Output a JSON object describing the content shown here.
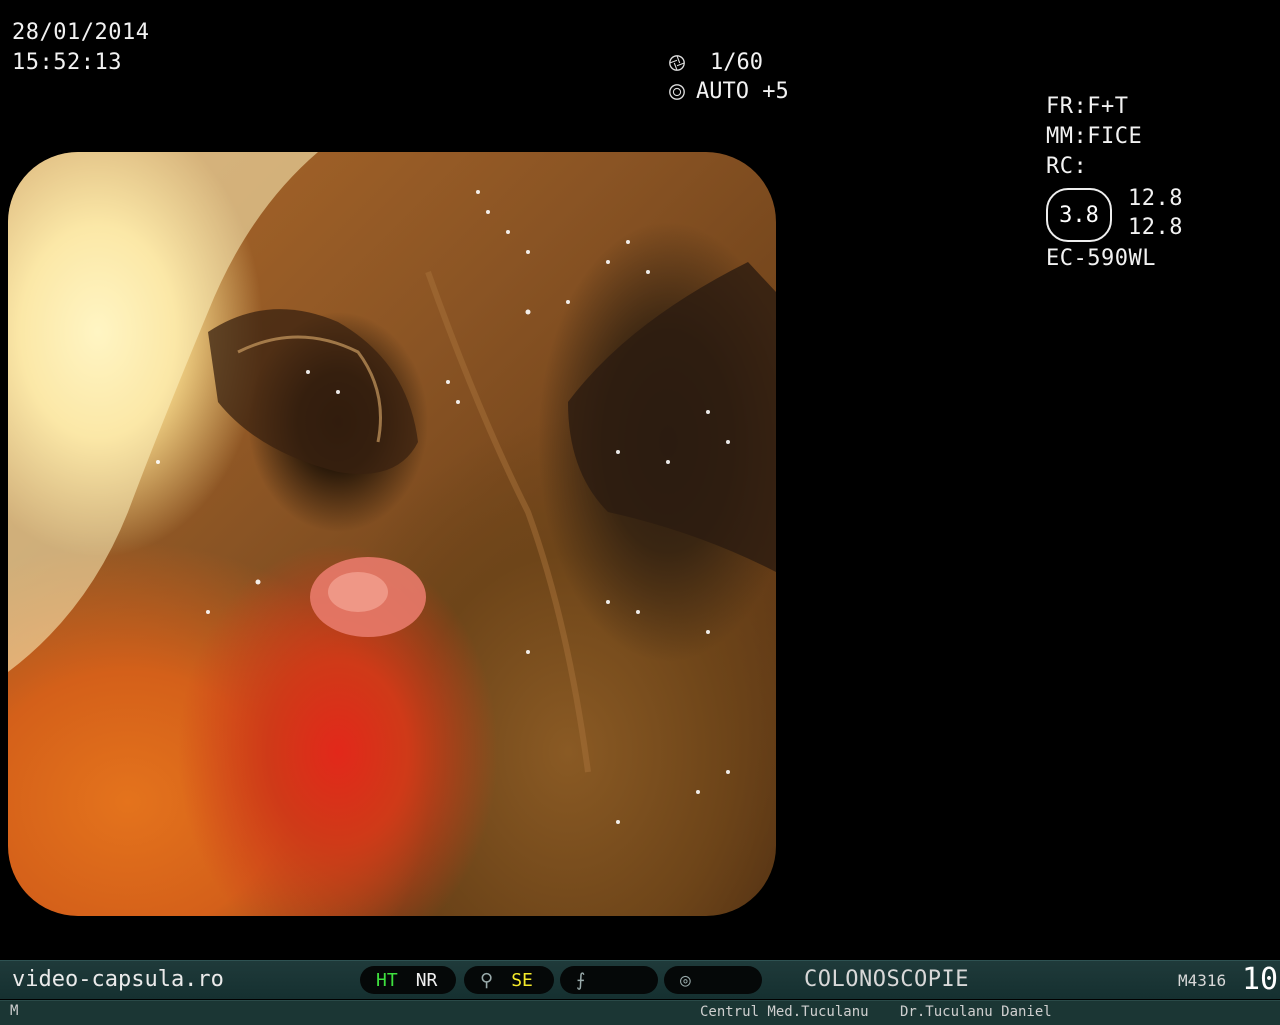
{
  "overlay": {
    "date": "28/01/2014",
    "time": "15:52:13",
    "shutter": "1/60",
    "exposure": "AUTO +5",
    "fr": "FR:F+T",
    "mm": "MM:FICE",
    "rc_label": "RC:",
    "rc_value": "3.8",
    "rc_value_1": "12.8",
    "rc_value_2": "12.8",
    "scope_model": "EC-590WL"
  },
  "status_bar": {
    "watermark": "video-capsula.ro",
    "ht": "HT",
    "nr": "NR",
    "se": "SE",
    "exam_type": "COLONOSCOPIE",
    "code": "M4316",
    "page_number": "10"
  },
  "footer": {
    "left": "M",
    "clinic": "Centrul Med.Tuculanu",
    "doctor": "Dr.Tuculanu Daniel"
  },
  "colors": {
    "ht": "#3ee03e",
    "se": "#f5ea2a",
    "status_bar_bg": "#1f3a3a"
  }
}
